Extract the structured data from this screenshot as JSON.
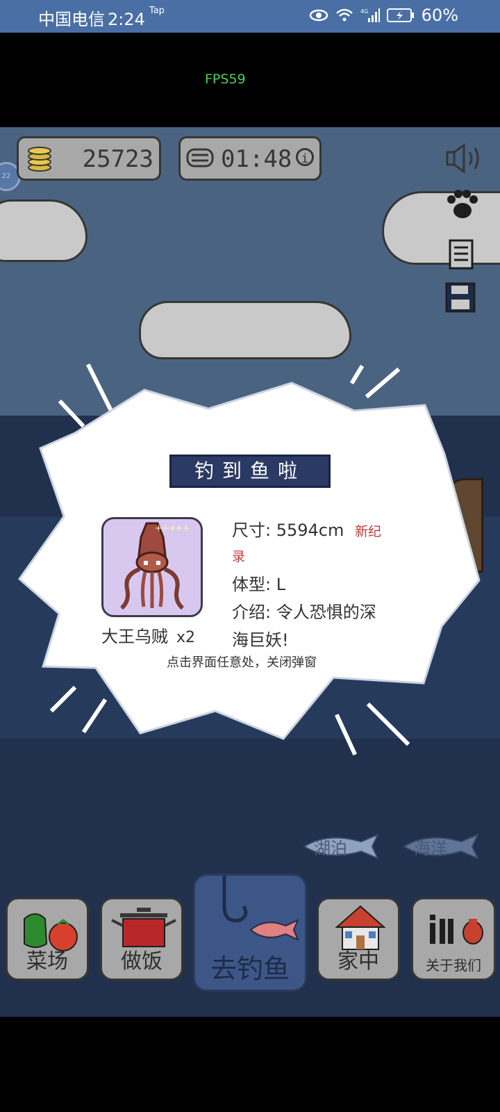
{
  "status_bar": {
    "carrier": "中国电信",
    "time": "2:24",
    "tap": "Tap",
    "battery": "60%"
  },
  "fps": "FPS59",
  "hud": {
    "coins": "25723",
    "timer": "01:48",
    "side_badge": "22"
  },
  "modal": {
    "title": "钓到鱼啦",
    "fish_name": "大王乌贼",
    "fish_count": "x2",
    "stars": "+++++",
    "size_line": "尺寸: 5594cm",
    "new_record_part1": "新纪",
    "new_record_part2": "录",
    "type_line": "体型: L",
    "intro_line1": "介绍: 令人恐惧的深",
    "intro_line2": "海巨妖!",
    "hint": "点击界面任意处，关闭弹窗"
  },
  "locations": {
    "lake": "湖泊",
    "ocean": "海洋"
  },
  "nav": {
    "vegetable_market": "菜场",
    "cooking": "做饭",
    "go_fishing": "去钓鱼",
    "home": "家中",
    "about_us": "关于我们"
  },
  "colors": {
    "sky": "#4a6381",
    "sea": "#20304d",
    "status_bar": "#4a6fa5",
    "new_record": "#c23a3a"
  }
}
